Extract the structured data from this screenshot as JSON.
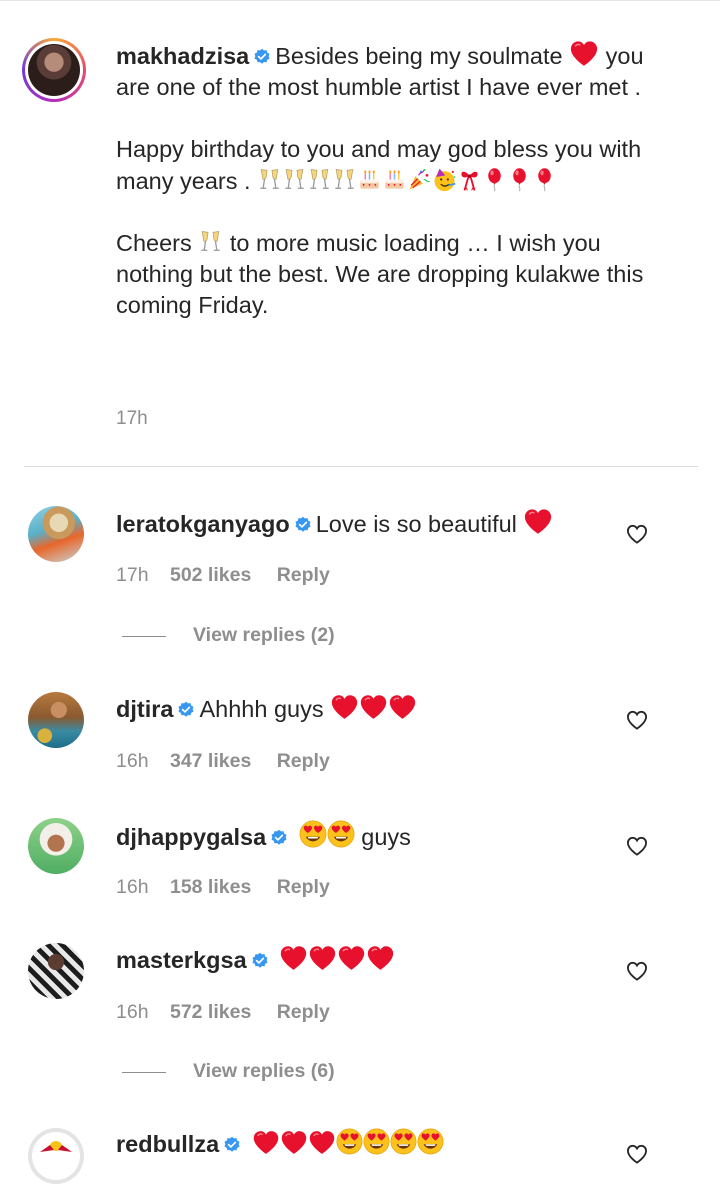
{
  "caption": {
    "username": "makhadzisa",
    "line1": "Besides being my soulmate",
    "line2": "you are one of the most humble artist I have ever met .",
    "line3": "Happy birthday to you and may god bless you with many years .",
    "line4_a": "Cheers",
    "line4_b": "to more music loading … I wish you nothing but the best. We are dropping kulakwe this coming Friday.",
    "time": "17h"
  },
  "comments": [
    {
      "username": "leratokganyago",
      "text": "Love is so beautiful",
      "time": "17h",
      "likes": "502 likes",
      "reply": "Reply",
      "view_replies": "View replies (2)"
    },
    {
      "username": "djtira",
      "text": "Ahhhh guys",
      "time": "16h",
      "likes": "347 likes",
      "reply": "Reply"
    },
    {
      "username": "djhappygalsa",
      "text": "guys",
      "time": "16h",
      "likes": "158 likes",
      "reply": "Reply"
    },
    {
      "username": "masterkgsa",
      "text": "",
      "time": "16h",
      "likes": "572 likes",
      "reply": "Reply",
      "view_replies": "View replies (6)"
    },
    {
      "username": "redbullza",
      "text": ""
    }
  ],
  "icons": {
    "verified": "verified-badge-icon",
    "heart": "heart-outline-icon",
    "red_heart": "red-heart-emoji",
    "heart_eyes": "heart-eyes-emoji",
    "champagne": "clinking-glasses-emoji",
    "cake": "birthday-cake-emoji",
    "popper": "party-popper-emoji",
    "party_face": "partying-face-emoji",
    "ribbon": "ribbon-emoji",
    "balloon": "balloon-emoji"
  },
  "colors": {
    "text": "#262626",
    "muted": "#8e8e8e",
    "verified": "#3897f0",
    "heart_emoji": "#e8112d"
  }
}
